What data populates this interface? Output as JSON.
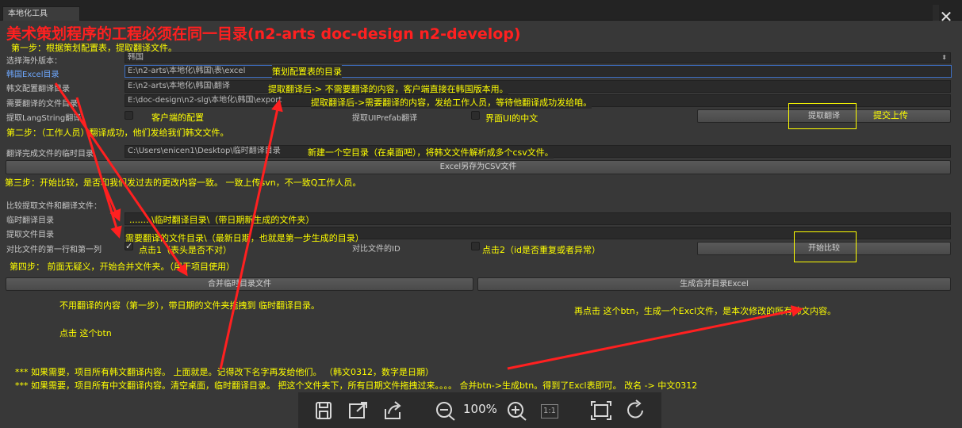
{
  "window": {
    "tab_title": "本地化工具",
    "close_glyph": "✕"
  },
  "header_note": "美术策划程序的工程必须在同一目录(n2-arts  doc-design  n2-develop)",
  "step1": {
    "heading": "第一步：根据策划配置表，提取翻译文件。",
    "version_label": "选择海外版本：",
    "version_value": "韩国",
    "excel_dir_label": "韩国Excel目录",
    "excel_dir_value": "E:\\n2-arts\\本地化\\韩国\\表\\excel",
    "excel_dir_note": "策划配置表的目录",
    "kr_config_label": "韩文配置翻译目录",
    "kr_config_value": "E:\\n2-arts\\本地化\\韩国\\翻译",
    "kr_config_note": "提取翻译后-> 不需要翻译的内容，客户端直接在韩国版本用。",
    "need_translate_label": "需要翻译的文件目录",
    "need_translate_value": "E:\\doc-design\\n2-slg\\本地化\\韩国\\export",
    "need_translate_note": "提取翻译后->需要翻译的内容，发给工作人员，等待他翻译成功发给咱。",
    "langstring_label": "提取LangString翻译",
    "client_config_note": "客户端的配置",
    "uiprefab_label": "提取UIPrefab翻译",
    "ui_cn_note": "界面UI的中文",
    "extract_button": "提取翻译",
    "submit_note": "提交上传"
  },
  "step2": {
    "heading": "第二步：（工作人员）翻译成功，他们发给我们韩文文件。",
    "temp_dir_label": "翻译完成文件的临时目录",
    "temp_dir_value": "C:\\Users\\enicen1\\Desktop\\临时翻译目录",
    "temp_dir_note": "新建一个空目录（在桌面吧），将韩文文件解析成多个csv文件。",
    "excel_to_csv_button": "Excel另存为CSV文件"
  },
  "step3": {
    "heading": "第三步：开始比较，是否和我们发过去的更改内容一致。  一致上传svn，不一致Q工作人员。",
    "compare_title": "比较提取文件和翻译文件：",
    "temp_label": "临时翻译目录",
    "temp_value": "........\\临时翻译目录\\（带日期新生成的文件夹）",
    "extract_label": "提取文件目录",
    "extract_value": "需要翻译的文件目录\\（最新日期，也就是第一步生成的目录）",
    "first_row_label": "对比文件的第一行和第一列",
    "click1_note": "点击1（表头是否不对）",
    "compare_id_label": "对比文件的ID",
    "click2_note": "点击2（id是否重复或者异常）",
    "start_compare_button": "开始比较"
  },
  "step4": {
    "heading": "第四步：  前面无疑义，开始合并文件夹。（用于项目使用）",
    "merge_button": "合并临时目录文件",
    "generate_button": "生成合并目录Excel",
    "note_left_1": "不用翻译的内容（第一步），带日期的文件夹拖拽到 临时翻译目录。",
    "note_left_2": "点击   这个btn",
    "note_right": "再点击 这个btn，生成一个Excl文件，是本次修改的所有韩文内容。",
    "footer_1": "*** 如果需要，项目所有韩文翻译内容。   上面就是。记得改下名字再发给他们。  （韩文0312，数字是日期）",
    "footer_2": "*** 如果需要，项目所有中文翻译内容。清空桌面，临时翻译目录。 把这个文件夹下，所有日期文件拖拽过来。。。。 合并btn->生成btn。得到了Excl表即可。 改名 -> 中文0312"
  },
  "viewer": {
    "zoom": "100%",
    "actual_size": "1:1"
  },
  "colors": {
    "annotation_red": "#ff2020",
    "annotation_yellow": "#ffff00",
    "panel": "#383838"
  }
}
